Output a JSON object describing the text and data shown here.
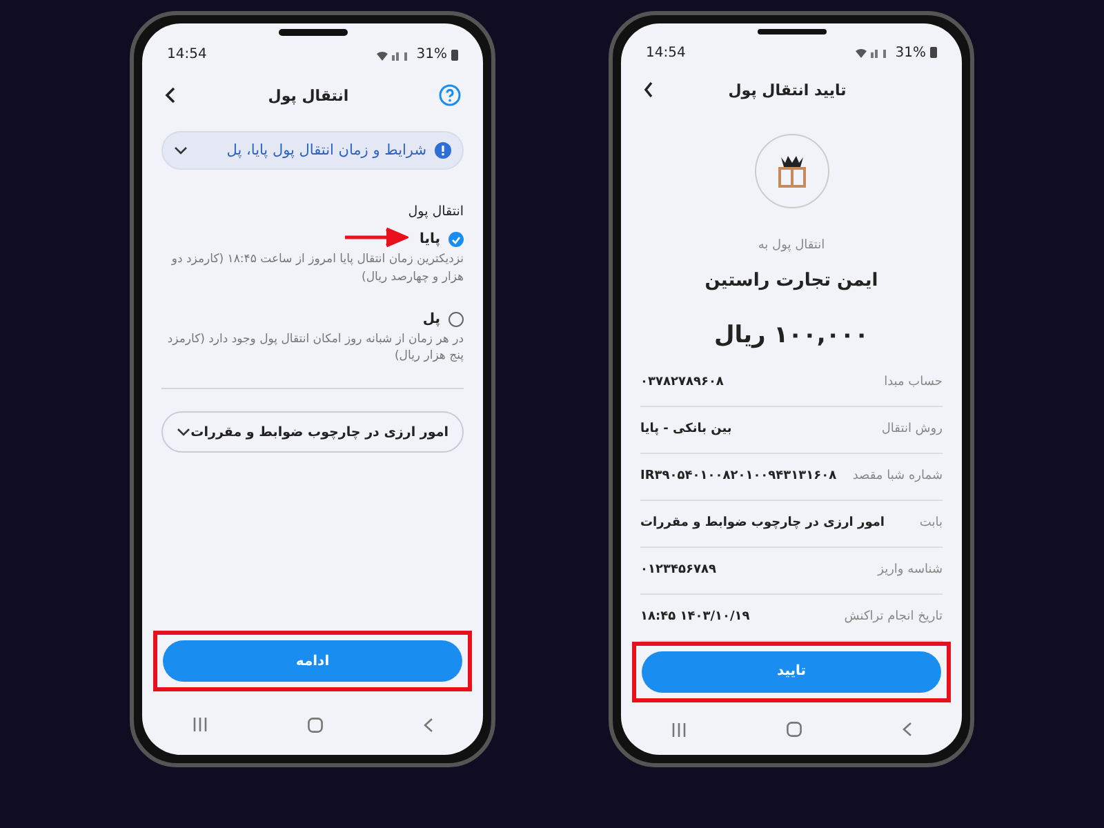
{
  "phones": [
    {
      "kind": "confirm",
      "status": {
        "time": "14:54",
        "battery": "31%"
      },
      "title": "تایید انتقال پول",
      "recipient_caption": "انتقال پول به",
      "recipient_name": "ایمن تجارت راستین",
      "amount": "۱۰۰,۰۰۰ ریال",
      "details": [
        {
          "label": "حساب مبدا",
          "value": "۰۳۷۸۲۷۸۹۶۰۸"
        },
        {
          "label": "روش انتقال",
          "value": "بین بانکی - پایا"
        },
        {
          "label": "شماره شبا مقصد",
          "value": "IR۳۹۰۵۴۰۱۰۰۸۲۰۱۰۰۹۴۳۱۳۱۶۰۸"
        },
        {
          "label": "بابت",
          "value": "امور ارزی در چارچوب ضوابط و مقررات"
        },
        {
          "label": "شناسه واریز",
          "value": "۰۱۲۳۴۵۶۷۸۹"
        },
        {
          "label": "تاریخ انجام تراکنش",
          "value": "۱۴۰۳/۱۰/۱۹ ۱۸:۴۵"
        }
      ],
      "button": {
        "label": "تایید",
        "highlighted": true
      }
    },
    {
      "kind": "transfer",
      "status": {
        "time": "14:54",
        "battery": "31%"
      },
      "title": "انتقال پول",
      "info_banner": "شرایط و زمان انتقال پول پایا، پل",
      "section_label": "انتقال پول",
      "options": [
        {
          "label": "پایا",
          "selected": true,
          "highlighted": true,
          "description": "نزدیکترین زمان انتقال پایا امروز از ساعت ۱۸:۴۵ (کارمزد دو هزار و چهارصد ریال)"
        },
        {
          "label": "پل",
          "selected": false,
          "highlighted": false,
          "description": "در هر زمان از شبانه روز امکان انتقال پول وجود دارد (کارمزد پنج هزار ریال)"
        }
      ],
      "purpose_dropdown": "امور ارزی در چارچوب ضوابط و مقررات",
      "button": {
        "label": "ادامه",
        "highlighted": true
      }
    }
  ]
}
